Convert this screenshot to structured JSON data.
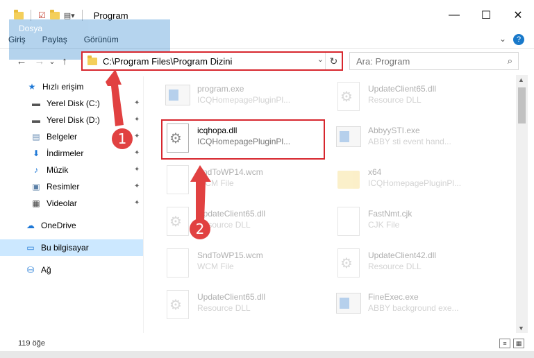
{
  "window": {
    "title": "Program",
    "minimize": "—",
    "maximize": "☐",
    "close": "✕"
  },
  "ribbon": {
    "tabs": [
      "Dosya",
      "Giriş",
      "Paylaş",
      "Görünüm"
    ],
    "help": "?",
    "expand": "⌄"
  },
  "nav": {
    "back": "←",
    "forward": "→",
    "recent": "⌄",
    "up": "↑",
    "path": "C:\\Program Files\\Program Dizini",
    "dropdown": "⌄",
    "refresh": "↻",
    "search_placeholder": "Ara: Program",
    "search_icon": "⌕"
  },
  "sidebar": {
    "items": [
      {
        "label": "Hızlı erişim",
        "icon": "★",
        "icon_color": "#1e78d6",
        "pinned": false
      },
      {
        "label": "Yerel Disk (C:)",
        "icon": "▬",
        "icon_color": "#555555",
        "pinned": true
      },
      {
        "label": "Yerel Disk (D:)",
        "icon": "▬",
        "icon_color": "#555555",
        "pinned": true
      },
      {
        "label": "Belgeler",
        "icon": "▤",
        "icon_color": "#6b8fb6",
        "pinned": true
      },
      {
        "label": "İndirmeler",
        "icon": "⬇",
        "icon_color": "#1e78d6",
        "pinned": true
      },
      {
        "label": "Müzik",
        "icon": "♪",
        "icon_color": "#1e78d6",
        "pinned": true
      },
      {
        "label": "Resimler",
        "icon": "▣",
        "icon_color": "#5a7fa6",
        "pinned": true
      },
      {
        "label": "Videolar",
        "icon": "▦",
        "icon_color": "#444444",
        "pinned": true
      },
      {
        "label": "OneDrive",
        "icon": "☁",
        "icon_color": "#1e78d6",
        "pinned": false
      },
      {
        "label": "Bu bilgisayar",
        "icon": "▭",
        "icon_color": "#1e78d6",
        "pinned": false,
        "selected": true
      },
      {
        "label": "Ağ",
        "icon": "⛁",
        "icon_color": "#1e78d6",
        "pinned": false
      }
    ],
    "pin_icon": "📌"
  },
  "files": [
    {
      "name": "program.exe",
      "type": "ICQHomepagePluginPl...",
      "kind": "exe"
    },
    {
      "name": "UpdateClient65.dll",
      "type": "Resource DLL",
      "kind": "dll"
    },
    {
      "name": "icqhopa.dll",
      "type": "ICQHomepagePluginPl...",
      "kind": "dll",
      "selected": true
    },
    {
      "name": "AbbyySTI.exe",
      "type": "ABBY sti event hand...",
      "kind": "exe"
    },
    {
      "name": "SndToWP14.wcm",
      "type": "WCM File",
      "kind": "page"
    },
    {
      "name": "x64",
      "type": "ICQHomepagePluginPl...",
      "kind": "folder"
    },
    {
      "name": "UpdateClient65.dll",
      "type": "Resource DLL",
      "kind": "dll"
    },
    {
      "name": "FastNmt.cjk",
      "type": "CJK File",
      "kind": "page"
    },
    {
      "name": "SndToWP15.wcm",
      "type": "WCM File",
      "kind": "page"
    },
    {
      "name": "UpdateClient42.dll",
      "type": "Resource DLL",
      "kind": "dll"
    },
    {
      "name": "UpdateClient65.dll",
      "type": "Resource DLL",
      "kind": "dll"
    },
    {
      "name": "FineExec.exe",
      "type": "ABBY background exe...",
      "kind": "exe"
    }
  ],
  "annotations": {
    "step1": "1",
    "step2": "2"
  },
  "status": {
    "count": "119 öğe"
  },
  "colors": {
    "accent": "#1979ca",
    "highlight": "#d7262d",
    "badge": "#e14141",
    "selection": "#cce8ff"
  }
}
